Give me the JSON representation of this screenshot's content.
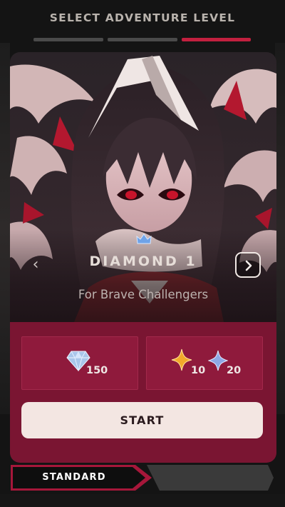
{
  "header": {
    "title": "SELECT ADVENTURE LEVEL",
    "active_step_color": "#c2203f",
    "step_count": 3,
    "active_step": 3
  },
  "level": {
    "name": "DIAMOND 1",
    "subtitle": "For Brave Challengers",
    "badge_icon": "crown-icon",
    "prev_icon": "chevron-left-icon",
    "next_icon": "chevron-right-icon"
  },
  "rewards": {
    "entry_cost": {
      "icon": "diamond-icon",
      "value": "150"
    },
    "gold_star": {
      "icon": "gold-star-icon",
      "value": "10"
    },
    "blue_star": {
      "icon": "blue-star-icon",
      "value": "20"
    }
  },
  "actions": {
    "start_label": "START"
  },
  "mode_tabs": {
    "active": "STANDARD"
  },
  "colors": {
    "panel": "#7a1532",
    "accent": "#c2203f",
    "button": "#f3e6e2"
  }
}
